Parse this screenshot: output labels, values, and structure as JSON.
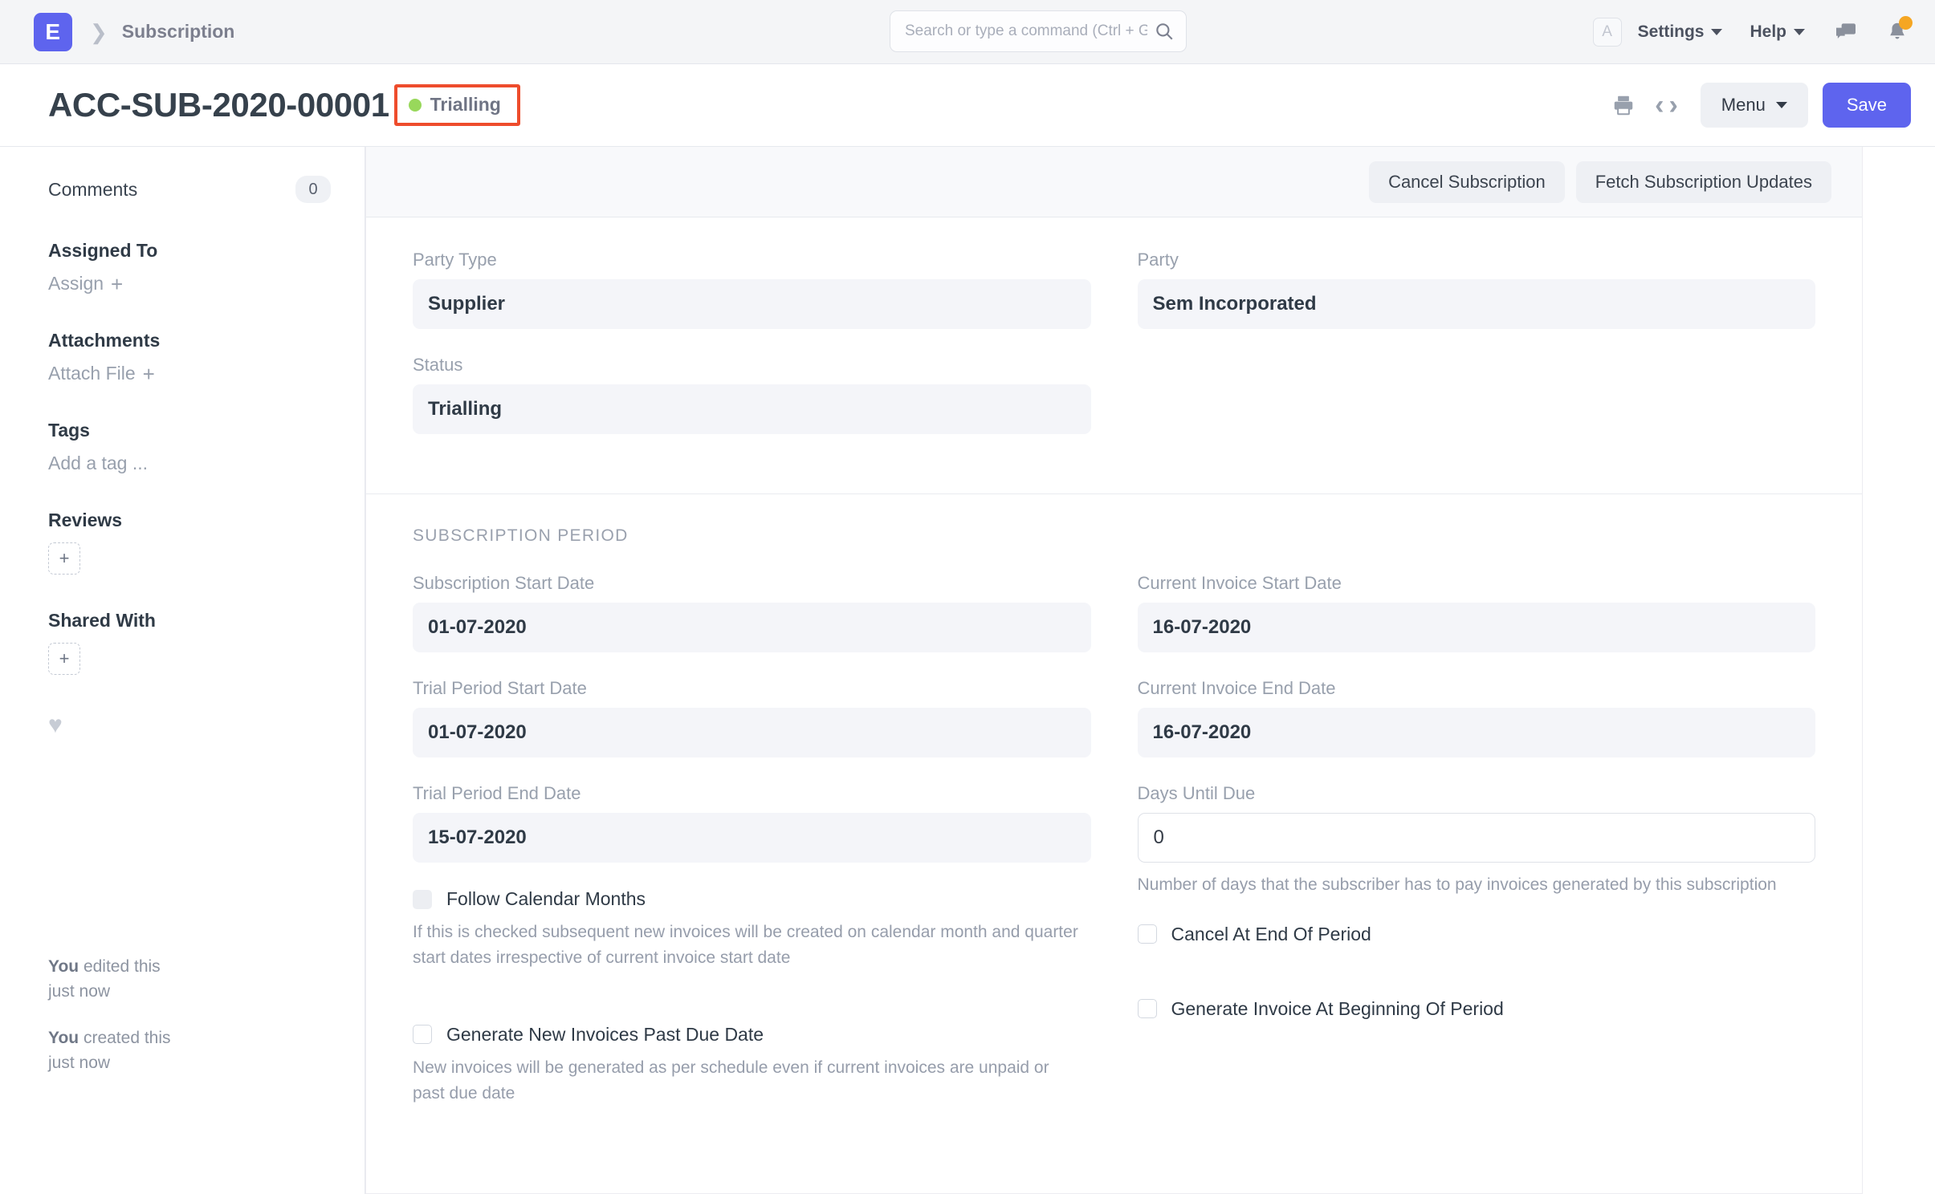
{
  "navbar": {
    "logo_letter": "E",
    "breadcrumb": "Subscription",
    "search_placeholder": "Search or type a command (Ctrl + G)",
    "search_value": "",
    "avatar_letter": "A",
    "settings_label": "Settings",
    "help_label": "Help",
    "icons": {
      "search": "search-icon",
      "chat": "chat-icon",
      "bell": "notification-bell-icon"
    }
  },
  "titlebar": {
    "doc_title": "ACC-SUB-2020-00001",
    "status_label": "Trialling",
    "status_dot_color": "#98d85b",
    "highlight_color": "#ee4c2c",
    "menu_label": "Menu",
    "save_label": "Save"
  },
  "sidebar": {
    "comments_label": "Comments",
    "comments_count": "0",
    "assigned_to_label": "Assigned To",
    "assign_action": "Assign",
    "attachments_label": "Attachments",
    "attach_action": "Attach File",
    "tags_label": "Tags",
    "add_tag_action": "Add a tag ...",
    "reviews_label": "Reviews",
    "shared_with_label": "Shared With",
    "add_glyph": "+",
    "history": [
      {
        "actor": "You",
        "action": "edited this",
        "time": "just now"
      },
      {
        "actor": "You",
        "action": "created this",
        "time": "just now"
      }
    ]
  },
  "main": {
    "action_buttons": [
      {
        "label": "Cancel Subscription",
        "name": "cancel-subscription-button"
      },
      {
        "label": "Fetch Subscription Updates",
        "name": "fetch-subscription-updates-button"
      }
    ],
    "party_section": {
      "party_type_label": "Party Type",
      "party_type_value": "Supplier",
      "party_label": "Party",
      "party_value": "Sem Incorporated",
      "status_label": "Status",
      "status_value": "Trialling"
    },
    "period_section": {
      "title": "SUBSCRIPTION PERIOD",
      "subscription_start_date_label": "Subscription Start Date",
      "subscription_start_date_value": "01-07-2020",
      "trial_period_start_date_label": "Trial Period Start Date",
      "trial_period_start_date_value": "01-07-2020",
      "trial_period_end_date_label": "Trial Period End Date",
      "trial_period_end_date_value": "15-07-2020",
      "current_invoice_start_date_label": "Current Invoice Start Date",
      "current_invoice_start_date_value": "16-07-2020",
      "current_invoice_end_date_label": "Current Invoice End Date",
      "current_invoice_end_date_value": "16-07-2020",
      "days_until_due_label": "Days Until Due",
      "days_until_due_value": "0",
      "days_until_due_help": "Number of days that the subscriber has to pay invoices generated by this subscription",
      "follow_calendar_months_label": "Follow Calendar Months",
      "follow_calendar_months_help": "If this is checked subsequent new invoices will be created on calendar month and quarter start dates irrespective of current invoice start date",
      "generate_new_invoices_past_due_label": "Generate New Invoices Past Due Date",
      "generate_new_invoices_past_due_help": "New invoices will be generated as per schedule even if current invoices are unpaid or past due date",
      "cancel_at_end_of_period_label": "Cancel At End Of Period",
      "generate_invoice_at_beginning_label": "Generate Invoice At Beginning Of Period"
    }
  }
}
